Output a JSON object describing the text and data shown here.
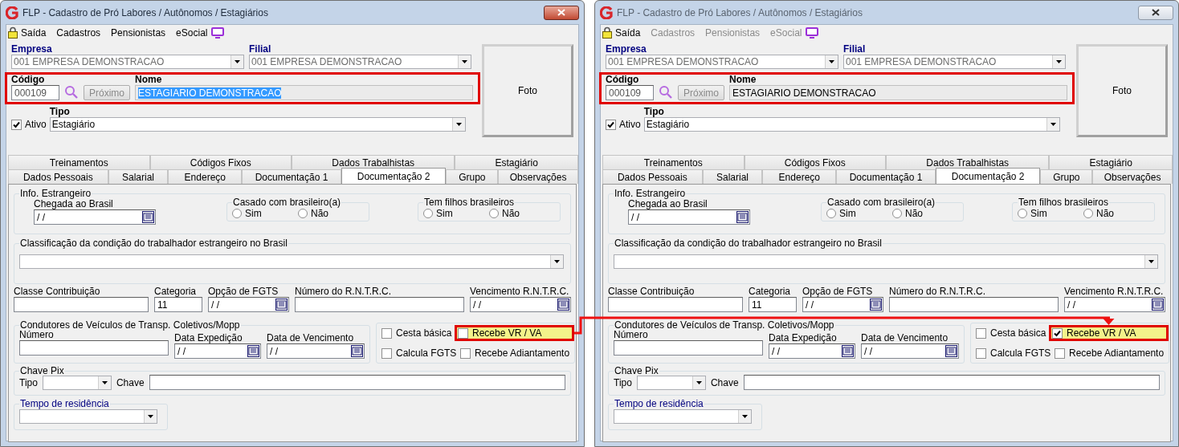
{
  "windows": [
    {
      "title": "FLP - Cadastro de Pró Labores / Autônomos / Estagiários",
      "active": true,
      "menu": [
        {
          "kind": "lock",
          "label": "Saída",
          "disabled": false
        },
        {
          "kind": "text",
          "label": "Cadastros",
          "disabled": false
        },
        {
          "kind": "text",
          "label": "Pensionistas",
          "disabled": false
        },
        {
          "kind": "text",
          "label": "eSocial",
          "disabled": false
        },
        {
          "kind": "monitor"
        }
      ],
      "empresa": {
        "label": "Empresa",
        "value": "001 EMPRESA DEMONSTRACAO",
        "disabled": true
      },
      "filial": {
        "label": "Filial",
        "value": "001 EMPRESA DEMONSTRACAO",
        "disabled": true
      },
      "foto": "Foto",
      "codigo": {
        "label": "Código",
        "value": "000109"
      },
      "proximo": {
        "label": "Próximo",
        "disabled": true
      },
      "nome": {
        "label": "Nome",
        "value": "ESTAGIARIO DEMONSTRACAO",
        "selected": true
      },
      "highlight_codigo_nome": true,
      "ativo": {
        "label": "Ativo",
        "checked": true
      },
      "tipo": {
        "label": "Tipo",
        "value": "Estagiário",
        "disabled": false
      },
      "tab_rows": [
        {
          "tabs": [
            {
              "label": "Treinamentos",
              "selected": false
            },
            {
              "label": "Códigos Fixos",
              "selected": false
            },
            {
              "label": "Dados Trabalhistas",
              "selected": false
            },
            {
              "label": "Estagiário",
              "selected": false
            }
          ]
        },
        {
          "tabs": [
            {
              "label": "Dados Pessoais",
              "selected": false
            },
            {
              "label": "Salarial",
              "selected": false
            },
            {
              "label": "Endereço",
              "selected": false
            },
            {
              "label": "Documentação 1",
              "selected": false
            },
            {
              "label": "Documentação 2",
              "selected": true
            },
            {
              "label": "Grupo",
              "selected": false
            },
            {
              "label": "Observações",
              "selected": false
            }
          ]
        }
      ],
      "info_estrangeiro": {
        "title": "Info. Estrangeiro",
        "chegada": {
          "label": "Chegada ao Brasil",
          "value": "/ /"
        },
        "groups": [
          {
            "title": "Casado com brasileiro(a)",
            "options": [
              {
                "label": "Sim",
                "selected": false
              },
              {
                "label": "Não",
                "selected": false
              }
            ]
          },
          {
            "title": "Tem filhos brasileiros",
            "options": [
              {
                "label": "Sim",
                "selected": false
              },
              {
                "label": "Não",
                "selected": false
              }
            ]
          }
        ]
      },
      "classificacao": {
        "title": "Classificação da condição do trabalhador estrangeiro no Brasil"
      },
      "fields_row": [
        {
          "kind": "text",
          "label": "Classe Contribuição"
        },
        {
          "kind": "text",
          "label": "Categoria",
          "value": "11"
        },
        {
          "kind": "date",
          "label": "Opção de FGTS",
          "value": "/ /"
        },
        {
          "kind": "text",
          "label": "Número do R.N.T.R.C."
        },
        {
          "kind": "date",
          "label": "Vencimento R.N.T.R.C.",
          "value": "/ /"
        }
      ],
      "condutores": {
        "title": "Condutores de Veículos de Transp. Coletivos/Mopp",
        "fields": [
          {
            "kind": "text",
            "label": "Número"
          },
          {
            "kind": "date",
            "label": "Data Expedição",
            "value": "/ /"
          },
          {
            "kind": "date",
            "label": "Data de Vencimento",
            "value": "/ /"
          }
        ]
      },
      "checkboxes": [
        {
          "label": "Cesta básica",
          "checked": false,
          "highlight": false
        },
        {
          "label": "Recebe VR / VA",
          "checked": false,
          "highlight": true
        },
        {
          "label": "Calcula FGTS",
          "checked": false,
          "highlight": false
        },
        {
          "label": "Recebe Adiantamento",
          "checked": false,
          "highlight": false
        }
      ],
      "chave_pix": {
        "title": "Chave Pix",
        "tipo_label": "Tipo",
        "chave_label": "Chave"
      },
      "tempo_residencia": {
        "title": "Tempo de residência"
      }
    },
    {
      "title": "FLP - Cadastro de Pró Labores / Autônomos / Estagiários",
      "active": false,
      "menu": [
        {
          "kind": "lock",
          "label": "Saída",
          "disabled": false
        },
        {
          "kind": "text",
          "label": "Cadastros",
          "disabled": true
        },
        {
          "kind": "text",
          "label": "Pensionistas",
          "disabled": true
        },
        {
          "kind": "text",
          "label": "eSocial",
          "disabled": true
        },
        {
          "kind": "monitor"
        }
      ],
      "empresa": {
        "label": "Empresa",
        "value": "001 EMPRESA DEMONSTRACAO",
        "disabled": true
      },
      "filial": {
        "label": "Filial",
        "value": "001 EMPRESA DEMONSTRACAO",
        "disabled": true
      },
      "foto": "Foto",
      "codigo": {
        "label": "Código",
        "value": "000109"
      },
      "proximo": {
        "label": "Próximo",
        "disabled": true
      },
      "nome": {
        "label": "Nome",
        "value": "ESTAGIARIO DEMONSTRACAO",
        "selected": false
      },
      "highlight_codigo_nome": true,
      "ativo": {
        "label": "Ativo",
        "checked": true
      },
      "tipo": {
        "label": "Tipo",
        "value": "Estagiário",
        "disabled": false
      },
      "tab_rows": [
        {
          "tabs": [
            {
              "label": "Treinamentos",
              "selected": false
            },
            {
              "label": "Códigos Fixos",
              "selected": false
            },
            {
              "label": "Dados Trabalhistas",
              "selected": false
            },
            {
              "label": "Estagiário",
              "selected": false
            }
          ]
        },
        {
          "tabs": [
            {
              "label": "Dados Pessoais",
              "selected": false
            },
            {
              "label": "Salarial",
              "selected": false
            },
            {
              "label": "Endereço",
              "selected": false
            },
            {
              "label": "Documentação 1",
              "selected": false
            },
            {
              "label": "Documentação 2",
              "selected": true
            },
            {
              "label": "Grupo",
              "selected": false
            },
            {
              "label": "Observações",
              "selected": false
            }
          ]
        }
      ],
      "info_estrangeiro": {
        "title": "Info. Estrangeiro",
        "chegada": {
          "label": "Chegada ao Brasil",
          "value": "/ /"
        },
        "groups": [
          {
            "title": "Casado com brasileiro(a)",
            "options": [
              {
                "label": "Sim",
                "selected": false
              },
              {
                "label": "Não",
                "selected": false
              }
            ]
          },
          {
            "title": "Tem filhos brasileiros",
            "options": [
              {
                "label": "Sim",
                "selected": false
              },
              {
                "label": "Não",
                "selected": false
              }
            ]
          }
        ]
      },
      "classificacao": {
        "title": "Classificação da condição do trabalhador estrangeiro no Brasil"
      },
      "fields_row": [
        {
          "kind": "text",
          "label": "Classe Contribuição"
        },
        {
          "kind": "text",
          "label": "Categoria",
          "value": "11"
        },
        {
          "kind": "date",
          "label": "Opção de FGTS",
          "value": "/ /"
        },
        {
          "kind": "text",
          "label": "Número do R.N.T.R.C."
        },
        {
          "kind": "date",
          "label": "Vencimento R.N.T.R.C.",
          "value": "/ /"
        }
      ],
      "condutores": {
        "title": "Condutores de Veículos de Transp. Coletivos/Mopp",
        "fields": [
          {
            "kind": "text",
            "label": "Número"
          },
          {
            "kind": "date",
            "label": "Data Expedição",
            "value": "/ /"
          },
          {
            "kind": "date",
            "label": "Data de Vencimento",
            "value": "/ /"
          }
        ]
      },
      "checkboxes": [
        {
          "label": "Cesta básica",
          "checked": false,
          "highlight": false
        },
        {
          "label": "Recebe VR / VA",
          "checked": true,
          "highlight": true
        },
        {
          "label": "Calcula FGTS",
          "checked": false,
          "highlight": false
        },
        {
          "label": "Recebe Adiantamento",
          "checked": false,
          "highlight": false
        }
      ],
      "chave_pix": {
        "title": "Chave Pix",
        "tipo_label": "Tipo",
        "chave_label": "Chave"
      },
      "tempo_residencia": {
        "title": "Tempo de residência"
      }
    }
  ]
}
